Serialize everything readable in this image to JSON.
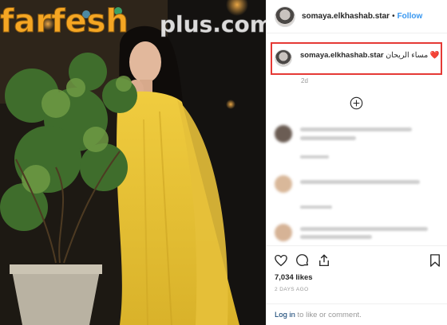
{
  "post": {
    "username": "somaya.elkhashab.star",
    "separator": "•",
    "follow_label": "Follow"
  },
  "caption": {
    "username": "somaya.elkhashab.star",
    "text": "مساء الريحان ❤️",
    "time": "2d"
  },
  "load_more_icon": "plus-circle-icon",
  "engagement": {
    "likes": "7,034 likes",
    "posted": "2 DAYS AGO"
  },
  "login": {
    "link_label": "Log in",
    "suffix": " to like or comment."
  },
  "watermark": {
    "brand": "farfesh",
    "suffix": "plus.com"
  },
  "colors": {
    "accent": "#3897f0",
    "highlight_box": "#e53935",
    "watermark_orange": "#f5a623",
    "dress_yellow": "#e8c43a"
  },
  "icons": [
    "heart-icon",
    "comment-icon",
    "share-icon",
    "bookmark-icon"
  ]
}
